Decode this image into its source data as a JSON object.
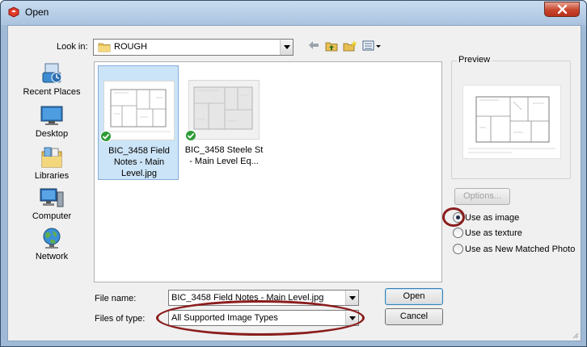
{
  "window": {
    "title": "Open",
    "app_icon": "sketchup-icon",
    "close_icon": "close-icon"
  },
  "lookin": {
    "label": "Look in:",
    "value": "ROUGH",
    "folder_icon": "folder-icon"
  },
  "toolbar": {
    "icons": [
      "back-arrow-icon",
      "up-folder-icon",
      "new-folder-icon",
      "view-menu-icon"
    ]
  },
  "places": [
    {
      "label": "Recent Places",
      "icon": "recent-places-icon"
    },
    {
      "label": "Desktop",
      "icon": "desktop-icon"
    },
    {
      "label": "Libraries",
      "icon": "libraries-icon"
    },
    {
      "label": "Computer",
      "icon": "computer-icon"
    },
    {
      "label": "Network",
      "icon": "network-icon"
    }
  ],
  "files": [
    {
      "name": "BIC_3458 Field Notes - Main Level.jpg",
      "name_lines": [
        "BIC_3458 Field",
        "Notes - Main",
        "Level.jpg"
      ],
      "selected": true
    },
    {
      "name": "BIC_3458 Steele St - Main Level Eq...",
      "name_lines": [
        "BIC_3458 Steele St",
        "- Main Level Eq..."
      ],
      "selected": false
    }
  ],
  "filename": {
    "label": "File name:",
    "value": "BIC_3458 Field Notes - Main Level.jpg"
  },
  "filetype": {
    "label": "Files of type:",
    "value": "All Supported Image Types"
  },
  "buttons": {
    "open": "Open",
    "cancel": "Cancel",
    "options": "Options..."
  },
  "preview": {
    "label": "Preview"
  },
  "import_options": [
    {
      "label": "Use as image",
      "checked": true
    },
    {
      "label": "Use as texture",
      "checked": false
    },
    {
      "label": "Use as New Matched Photo",
      "checked": false
    }
  ],
  "colors": {
    "highlight_ellipse": "#8b1d1d",
    "selection": "#cce4f7",
    "title_bar": "#b9cfe6"
  }
}
